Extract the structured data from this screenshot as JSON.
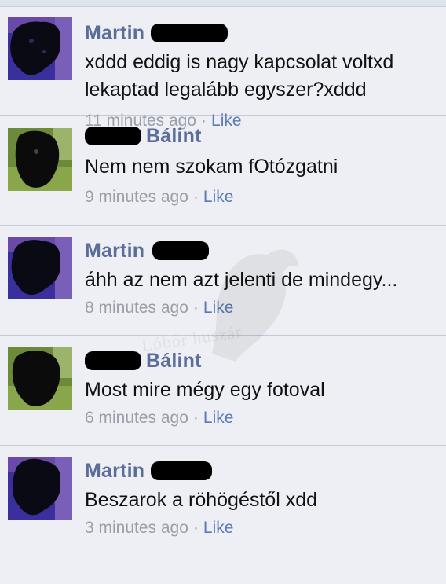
{
  "comments": [
    {
      "author": "Martin",
      "text": "xddd eddig is nagy kapcsolat voltxd lekaptad legalább egyszer?xddd",
      "time": "11 minutes ago",
      "separator": "·",
      "like_label": "Like"
    },
    {
      "author": "Bálint",
      "text": "Nem nem szokam fOtózgatni",
      "time": "9 minutes ago",
      "separator": "·",
      "like_label": "Like"
    },
    {
      "author": "Martin",
      "text": "áhh az nem azt jelenti de mindegy...",
      "time": "8 minutes ago",
      "separator": "·",
      "like_label": "Like"
    },
    {
      "author": "Bálint",
      "text": "Most mire mégy egy fotoval",
      "time": "6 minutes ago",
      "separator": "·",
      "like_label": "Like"
    },
    {
      "author": "Martin",
      "text": "Beszarok a röhögéstől xdd",
      "time": "3 minutes ago",
      "separator": "·",
      "like_label": "Like"
    }
  ],
  "watermark_text": "Lóbőr huszár",
  "colors": {
    "name": "#5b6e9a",
    "like": "#5b7bb5",
    "meta": "#9a9ea8",
    "background": "#edeff4"
  }
}
